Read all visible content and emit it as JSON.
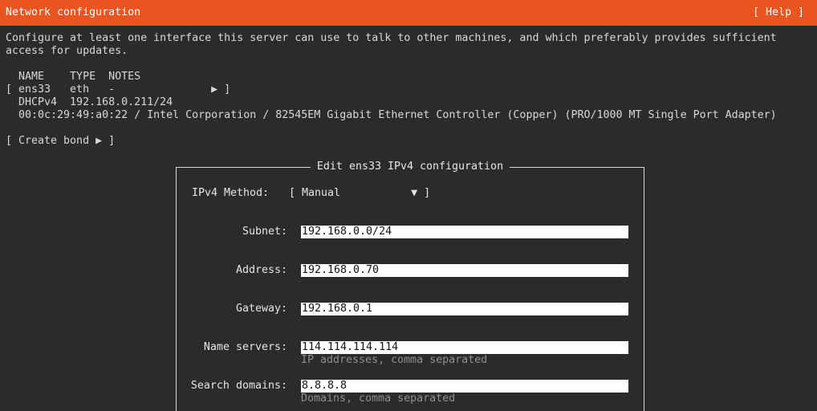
{
  "title_bar": {
    "title": "Network configuration",
    "help_label": "[ Help ]"
  },
  "intro": {
    "line1": "Configure at least one interface this server can use to talk to other machines, and which preferably provides sufficient",
    "line2": "access for updates."
  },
  "interfaces": {
    "header": "  NAME    TYPE  NOTES",
    "row": "[ ens33   eth   -               ▶ ]",
    "dhcp": "  DHCPv4  192.168.0.211/24",
    "hw": "  00:0c:29:49:a0:22 / Intel Corporation / 82545EM Gigabit Ethernet Controller (Copper) (PRO/1000 MT Single Port Adapter)"
  },
  "create_bond_label": "[ Create bond ▶ ]",
  "dialog": {
    "title": "Edit ens33 IPv4 configuration",
    "method_label": "IPv4 Method:",
    "method_value": "[ Manual           ▼ ]",
    "subnet_label": "Subnet:",
    "subnet_value": "192.168.0.0/24",
    "address_label": "Address:",
    "address_value": "192.168.0.70",
    "gateway_label": "Gateway:",
    "gateway_value": "192.168.0.1",
    "nameservers_label": "Name servers:",
    "nameservers_value": "114.114.114.114",
    "nameservers_hint": "IP addresses, comma separated",
    "search_label": "Search domains:",
    "search_value": "8.8.8.8",
    "search_hint": "Domains, comma separated"
  },
  "colors": {
    "accent": "#e95420",
    "background": "#2b2b2b",
    "text": "#d8d8d8",
    "field_bg": "#ffffff"
  }
}
